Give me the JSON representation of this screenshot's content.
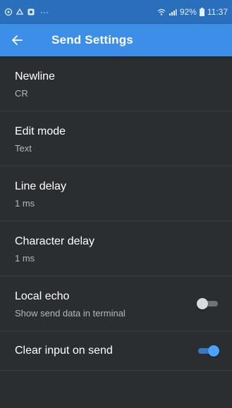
{
  "status_bar": {
    "signal": "92%",
    "time": "11:37",
    "icons": [
      "sync-icon",
      "alarm-icon",
      "app-icon",
      "more-dots-icon",
      "wifi-icon",
      "signal-icon",
      "battery-icon"
    ]
  },
  "app_bar": {
    "title": "Send Settings",
    "back_icon": "arrow-left-icon"
  },
  "settings": [
    {
      "title": "Newline",
      "value": "CR"
    },
    {
      "title": "Edit mode",
      "value": "Text"
    },
    {
      "title": "Line delay",
      "value": "1 ms"
    },
    {
      "title": "Character delay",
      "value": "1 ms"
    },
    {
      "title": "Local echo",
      "value": "Show send data in terminal",
      "toggle": false
    },
    {
      "title": "Clear input on send",
      "toggle": true
    }
  ],
  "colors": {
    "app_bar": "#3d8ee6",
    "status_bar": "#2a6fbb",
    "background": "#2b2e31",
    "toggle_on": "#4aa3ff"
  }
}
